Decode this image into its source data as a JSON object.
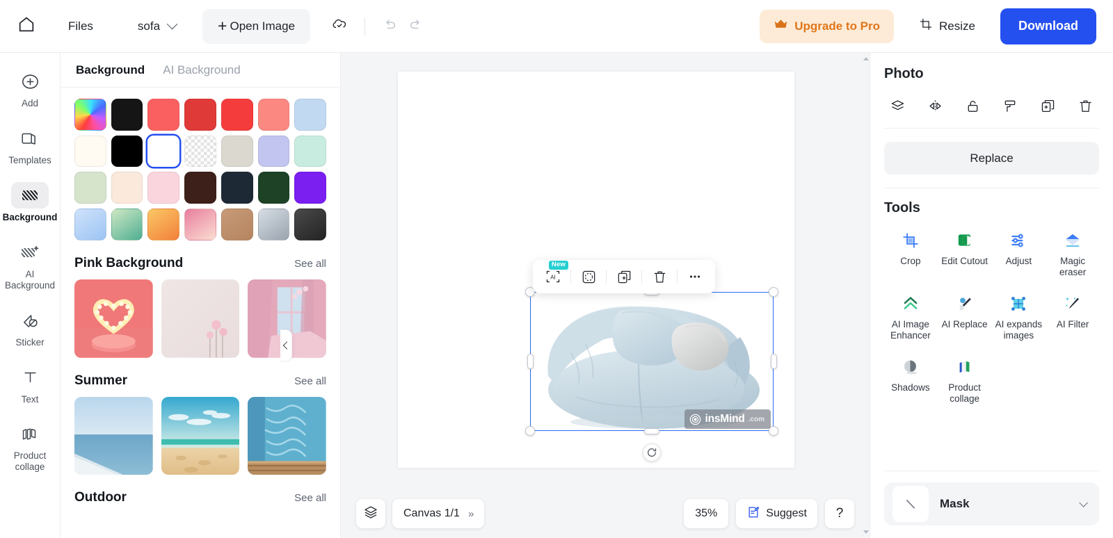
{
  "topbar": {
    "home_icon": "home-icon",
    "files_label": "Files",
    "doc_name": "sofa",
    "open_image_label": "Open Image",
    "plus_glyph": "+",
    "cloud_icon": "cloud-saved-icon",
    "undo_icon": "undo-icon",
    "redo_icon": "redo-icon",
    "upgrade_label": "Upgrade to Pro",
    "upgrade_icon": "crown-icon",
    "upgrade_bg": "#fdebd7",
    "upgrade_color": "#e0761a",
    "resize_label": "Resize",
    "resize_icon": "crop-frame-icon",
    "download_label": "Download",
    "download_bg": "#2550f0"
  },
  "rail": {
    "items": [
      {
        "label": "Add",
        "icon": "plus-circle-icon",
        "active": false
      },
      {
        "label": "Templates",
        "icon": "templates-icon",
        "active": false
      },
      {
        "label": "Background",
        "icon": "background-hatch-icon",
        "active": true
      },
      {
        "label": "AI Background",
        "icon": "ai-background-icon",
        "active": false
      },
      {
        "label": "Sticker",
        "icon": "sticker-icon",
        "active": false
      },
      {
        "label": "Text",
        "icon": "text-icon",
        "active": false
      },
      {
        "label": "Product collage",
        "icon": "product-collage-icon",
        "active": false
      }
    ]
  },
  "panel": {
    "tabs": [
      {
        "label": "Background",
        "active": true
      },
      {
        "label": "AI Background",
        "active": false
      }
    ],
    "swatches": [
      {
        "name": "color-picker",
        "type": "picker",
        "selected": false
      },
      {
        "name": "near-black",
        "color": "#151515",
        "selected": false
      },
      {
        "name": "coral-red",
        "color": "#fb6060",
        "selected": false
      },
      {
        "name": "crimson-red",
        "color": "#e03a38",
        "selected": false
      },
      {
        "name": "bright-red",
        "color": "#f53c3c",
        "selected": false
      },
      {
        "name": "salmon-pink",
        "color": "#fb8881",
        "selected": false
      },
      {
        "name": "light-blue",
        "color": "#c2d9f2",
        "selected": false
      },
      {
        "name": "ivory-cream",
        "color": "#fffaf2",
        "selected": false
      },
      {
        "name": "pure-black",
        "color": "#000000",
        "selected": false
      },
      {
        "name": "white",
        "color": "#ffffff",
        "selected": true
      },
      {
        "name": "transparent",
        "type": "checker",
        "selected": false
      },
      {
        "name": "warm-grey",
        "color": "#dbd8d0",
        "selected": false
      },
      {
        "name": "periwinkle",
        "color": "#c2c5ef",
        "selected": false
      },
      {
        "name": "mint",
        "color": "#c8ece0",
        "selected": false
      },
      {
        "name": "sage-green",
        "color": "#d5e4cb",
        "selected": false
      },
      {
        "name": "peach-cream",
        "color": "#fbe9db",
        "selected": false
      },
      {
        "name": "baby-pink",
        "color": "#fad5dd",
        "selected": false
      },
      {
        "name": "dark-brown",
        "color": "#3d2019",
        "selected": false
      },
      {
        "name": "navy-charcoal",
        "color": "#1e2936",
        "selected": false
      },
      {
        "name": "forest-green",
        "color": "#1d4226",
        "selected": false
      },
      {
        "name": "violet",
        "color": "#7b1ef0",
        "selected": false
      },
      {
        "name": "blue-gradient",
        "type": "grad",
        "color": "#cfe2fb",
        "color2": "#9cc4f3",
        "selected": false
      },
      {
        "name": "green-gradient",
        "type": "grad",
        "color": "#cfe8c4",
        "color2": "#4fae92",
        "selected": false
      },
      {
        "name": "orange-gradient",
        "type": "grad",
        "color": "#fbc765",
        "color2": "#f2803b",
        "selected": false
      },
      {
        "name": "pink-gradient",
        "type": "grad",
        "color": "#e87e9f",
        "color2": "#fbded2",
        "selected": false
      },
      {
        "name": "tan-gradient",
        "type": "grad",
        "color": "#c99a78",
        "color2": "#b4855f",
        "selected": false
      },
      {
        "name": "silver-gradient",
        "type": "grad",
        "color": "#d6dde5",
        "color2": "#9aa4ae",
        "selected": false
      },
      {
        "name": "dark-gradient",
        "type": "grad",
        "color": "#4a4a4a",
        "color2": "#232323",
        "selected": false
      }
    ],
    "sections": [
      {
        "title": "Pink Background",
        "see_all": "See all",
        "thumbs": [
          "pink-heart-podium",
          "pink-wall-flowers",
          "pink-curtain-window"
        ]
      },
      {
        "title": "Summer",
        "see_all": "See all",
        "thumbs": [
          "calm-ocean-horizon",
          "sandy-beach-sky",
          "pool-water-deck"
        ]
      },
      {
        "title": "Outdoor",
        "see_all": "See all",
        "thumbs": []
      }
    ],
    "collapse_icon": "chevron-left-icon"
  },
  "canvas": {
    "object_toolbar": [
      {
        "name": "ai-tool",
        "label": "AI",
        "badge": "New",
        "badge_color": "#27cfd1"
      },
      {
        "name": "cutout-tool",
        "label": "",
        "badge": ""
      },
      {
        "name": "duplicate-tool",
        "label": "",
        "badge": ""
      },
      {
        "name": "delete-tool",
        "label": "",
        "badge": ""
      },
      {
        "name": "more-options",
        "label": "",
        "badge": ""
      }
    ],
    "selection": {
      "color": "#2b6bf5"
    },
    "watermark": {
      "text": "insMind",
      "suffix": ".com"
    },
    "rotate_icon": "rotate-icon"
  },
  "bottombar": {
    "layers_icon": "layers-icon",
    "canvas_label": "Canvas 1/1",
    "canvas_chevron": "»",
    "zoom_level": "35%",
    "suggest_label": "Suggest",
    "suggest_icon": "suggest-icon",
    "help_label": "?"
  },
  "inspector": {
    "title": "Photo",
    "photo_icons": [
      {
        "name": "layer-order-icon"
      },
      {
        "name": "flip-horizontal-icon"
      },
      {
        "name": "unlock-icon"
      },
      {
        "name": "paint-roller-icon"
      },
      {
        "name": "duplicate-icon"
      },
      {
        "name": "trash-icon"
      }
    ],
    "replace_label": "Replace",
    "tools_title": "Tools",
    "tools": [
      {
        "label": "Crop",
        "icon": "crop-icon"
      },
      {
        "label": "Edit Cutout",
        "icon": "edit-cutout-icon"
      },
      {
        "label": "Adjust",
        "icon": "adjust-sliders-icon"
      },
      {
        "label": "Magic eraser",
        "icon": "magic-eraser-icon"
      },
      {
        "label": "AI Image Enhancer",
        "icon": "ai-enhancer-icon"
      },
      {
        "label": "AI Replace",
        "icon": "ai-replace-brush-icon"
      },
      {
        "label": "AI expands images",
        "icon": "ai-expand-icon"
      },
      {
        "label": "AI Filter",
        "icon": "ai-filter-wand-icon"
      },
      {
        "label": "Shadows",
        "icon": "shadows-icon"
      },
      {
        "label": "Product collage",
        "icon": "product-collage-icon"
      }
    ],
    "mask": {
      "label": "Mask",
      "thumb_icon": "diagonal-line-icon",
      "chevron": "chevron-down-icon"
    }
  }
}
